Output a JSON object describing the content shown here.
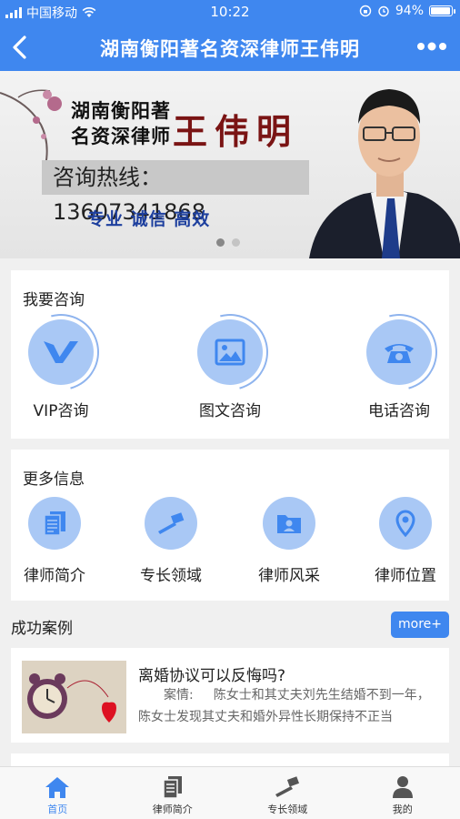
{
  "status_bar": {
    "carrier": "中国移动",
    "time": "10:22",
    "battery": "94%",
    "battery_level": 0.94
  },
  "nav": {
    "title": "湖南衡阳著名资深律师王伟明"
  },
  "banner": {
    "subtitle_line1": "湖南衡阳著",
    "subtitle_line2": "名资深律师",
    "name": "王伟明",
    "hotline": "咨询热线：13607341868",
    "slogan": "专业 诚信 高效",
    "slide_count": 2,
    "active_slide": 1
  },
  "consult": {
    "title": "我要咨询",
    "items": [
      {
        "label": "VIP咨询",
        "icon": "vip-icon"
      },
      {
        "label": "图文咨询",
        "icon": "image-icon"
      },
      {
        "label": "电话咨询",
        "icon": "phone-icon"
      }
    ]
  },
  "more_info": {
    "title": "更多信息",
    "items": [
      {
        "label": "律师简介",
        "icon": "document-icon"
      },
      {
        "label": "专长领域",
        "icon": "gavel-icon"
      },
      {
        "label": "律师风采",
        "icon": "folder-user-icon"
      },
      {
        "label": "律师位置",
        "icon": "location-pin-icon"
      }
    ]
  },
  "cases": {
    "title": "成功案例",
    "more_label": "more+",
    "items": [
      {
        "title": "离婚协议可以反悔吗?",
        "label": "案情:",
        "text": "陈女士和其丈夫刘先生结婚不到一年，陈女士发现其丈夫和婚外异性长期保持不正当"
      }
    ]
  },
  "tabbar": {
    "items": [
      {
        "label": "首页",
        "icon": "home-icon",
        "active": true
      },
      {
        "label": "律师简介",
        "icon": "document-icon",
        "active": false
      },
      {
        "label": "专长领域",
        "icon": "gavel-icon",
        "active": false
      },
      {
        "label": "我的",
        "icon": "user-icon",
        "active": false
      }
    ]
  },
  "colors": {
    "primary": "#3f87ef",
    "icon_bg": "#a9c8f5",
    "icon_fg": "#3f87ef",
    "page_bg": "#f0f0f0"
  }
}
